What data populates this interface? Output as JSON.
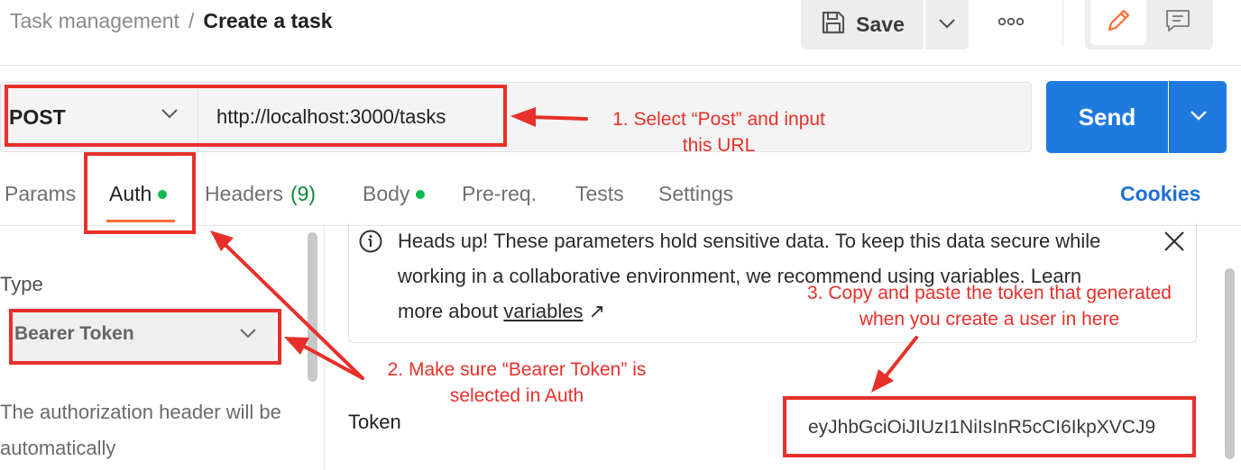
{
  "breadcrumb": {
    "parent": "Task management",
    "separator": "/",
    "current": "Create a task"
  },
  "toolbar": {
    "save_label": "Save"
  },
  "request": {
    "method": "POST",
    "url": "http://localhost:3000/tasks",
    "send_label": "Send"
  },
  "tabs": [
    {
      "label": "Params"
    },
    {
      "label": "Auth",
      "active": true,
      "status_dot": true
    },
    {
      "label": "Headers",
      "count": "(9)"
    },
    {
      "label": "Body",
      "status_dot": true
    },
    {
      "label": "Pre-req."
    },
    {
      "label": "Tests"
    },
    {
      "label": "Settings"
    }
  ],
  "cookies_label": "Cookies",
  "auth": {
    "type_label": "Type",
    "type_value": "Bearer Token",
    "description": "The authorization header will be automatically"
  },
  "info": {
    "text": "Heads up! These parameters hold sensitive data. To keep this data secure while working in a collaborative environment, we recommend using variables. Learn more about ",
    "link_label": "variables",
    "link_suffix": "↗"
  },
  "token": {
    "label": "Token",
    "value": "eyJhbGciOiJIUzI1NiIsInR5cCI6IkpXVCJ9"
  },
  "annotations": {
    "note1_line1": "1. Select “Post” and input",
    "note1_line2": "this URL",
    "note2_line1": "2. Make sure “Bearer Token” is",
    "note2_line2": "selected in Auth",
    "note3_line1": "3. Copy and paste the token that generated",
    "note3_line2": "when you create a user in here"
  },
  "colors": {
    "accent": "#ff6c37",
    "send": "#1f7ae0",
    "annotation": "#e8302a",
    "status_dot": "#0cbb52",
    "link": "#1f6fd4"
  },
  "icons": [
    "save-icon",
    "chevron-down-icon",
    "more-horizontal-icon",
    "pencil-icon",
    "comment-icon",
    "info-icon",
    "close-icon"
  ]
}
